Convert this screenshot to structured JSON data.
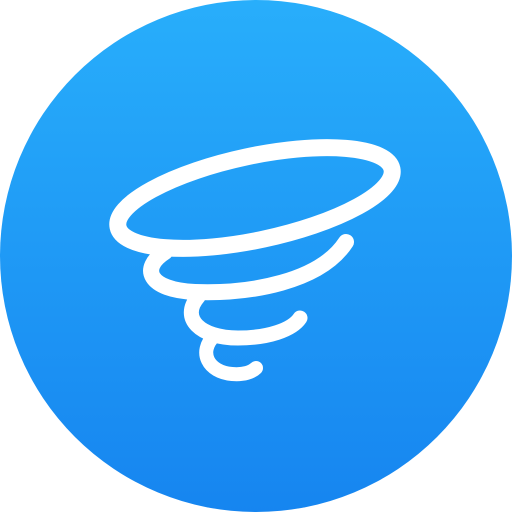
{
  "icon": {
    "name": "tornado-icon",
    "background_shape": "circle",
    "gradient_top": "#28AEFB",
    "gradient_bottom": "#1685F0",
    "glyph_color": "#FFFFFF"
  }
}
